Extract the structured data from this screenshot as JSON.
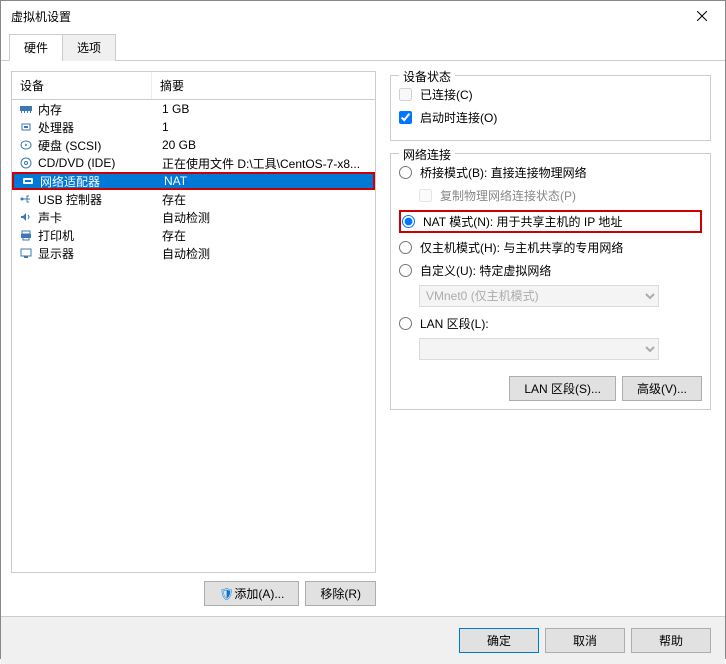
{
  "window": {
    "title": "虚拟机设置"
  },
  "tabs": {
    "hardware": "硬件",
    "options": "选项"
  },
  "list": {
    "header_device": "设备",
    "header_summary": "摘要",
    "rows": [
      {
        "icon": "memory",
        "device": "内存",
        "summary": "1 GB"
      },
      {
        "icon": "cpu",
        "device": "处理器",
        "summary": "1"
      },
      {
        "icon": "disk",
        "device": "硬盘 (SCSI)",
        "summary": "20 GB"
      },
      {
        "icon": "cd",
        "device": "CD/DVD (IDE)",
        "summary": "正在使用文件 D:\\工具\\CentOS-7-x8..."
      },
      {
        "icon": "net",
        "device": "网络适配器",
        "summary": "NAT",
        "selected": true
      },
      {
        "icon": "usb",
        "device": "USB 控制器",
        "summary": "存在"
      },
      {
        "icon": "sound",
        "device": "声卡",
        "summary": "自动检测"
      },
      {
        "icon": "printer",
        "device": "打印机",
        "summary": "存在"
      },
      {
        "icon": "display",
        "device": "显示器",
        "summary": "自动检测"
      }
    ]
  },
  "buttons": {
    "add": "添加(A)...",
    "remove": "移除(R)"
  },
  "status": {
    "legend": "设备状态",
    "connected": "已连接(C)",
    "connect_at_poweron": "启动时连接(O)"
  },
  "network": {
    "legend": "网络连接",
    "bridged": "桥接模式(B): 直接连接物理网络",
    "replicate": "复制物理网络连接状态(P)",
    "nat": "NAT 模式(N): 用于共享主机的 IP 地址",
    "hostonly": "仅主机模式(H): 与主机共享的专用网络",
    "custom": "自定义(U): 特定虚拟网络",
    "vmnet_option": "VMnet0 (仅主机模式)",
    "lan_segment": "LAN 区段(L):",
    "lan_btn": "LAN 区段(S)...",
    "advanced_btn": "高级(V)..."
  },
  "footer": {
    "ok": "确定",
    "cancel": "取消",
    "help": "帮助"
  }
}
